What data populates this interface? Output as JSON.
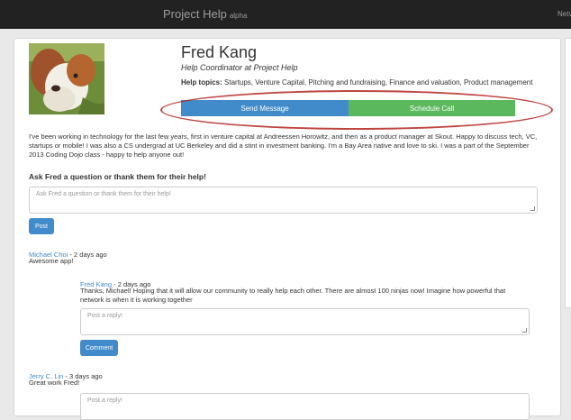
{
  "navbar": {
    "brand": "Project Help",
    "brand_badge": "alpha",
    "right_link": "Netv"
  },
  "profile": {
    "name": "Fred Kang",
    "role": "Help Coordinator at Project Help",
    "topics_label": "Help topics:",
    "topics": "Startups, Venture Capital, Pitching and fundraising, Finance and valuation, Product management",
    "send_message_label": "Send Message",
    "schedule_call_label": "Schedule Call",
    "bio": "I've been working in technology for the last few years, first in venture capital at Andreessen Horowitz, and then as a product manager at Skout. Happy to discuss tech, VC, startups or mobile! I was also a CS undergrad at UC Berkeley and did a stint in investment banking. I'm a Bay Area native and love to ski. I was a part of the September 2013 Coding Dojo class - happy to help anyone out!"
  },
  "ask": {
    "title": "Ask Fred a question or thank them for their help!",
    "placeholder": "Ask Fred a question or thank them for their help!",
    "post_label": "Post"
  },
  "comments": [
    {
      "author": "Michael Choi",
      "time": " - 2 days ago",
      "text": "Awesome app!",
      "reply": {
        "author": "Fred Kang",
        "time": " - 2 days ago",
        "text": "Thanks, Michael! Hoping that it will allow our community to really help each other. There are almost 100 ninjas now! Imagine how powerful that network is when it is working together"
      },
      "reply_placeholder": "Post a reply!",
      "comment_label": "Comment"
    },
    {
      "author": "Jerry C. Lin",
      "time": " - 3 days ago",
      "text": "Great work Fred!",
      "reply_placeholder": "Post a reply!"
    }
  ],
  "colors": {
    "primary": "#428bca",
    "success": "#5cb85c",
    "annotation": "#b3261e",
    "navbar": "#222222"
  }
}
